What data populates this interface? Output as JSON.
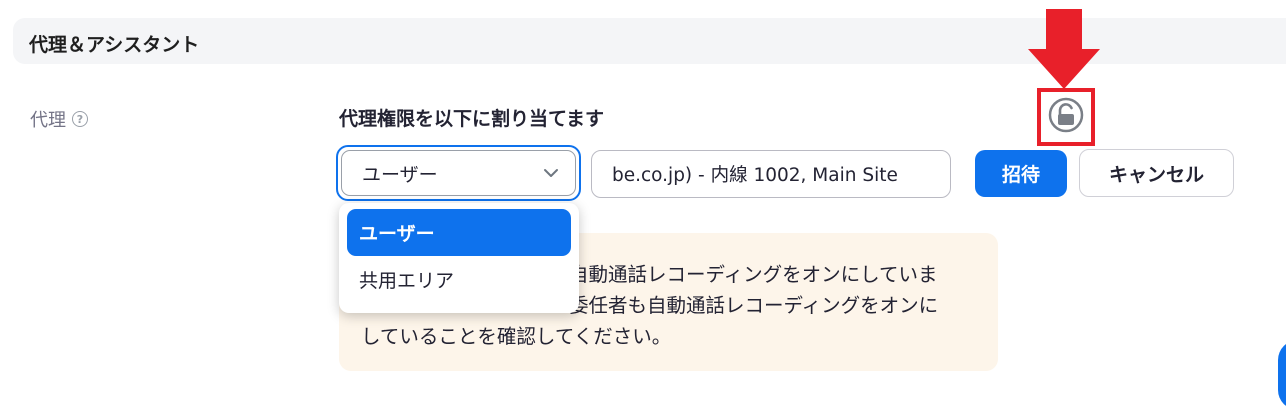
{
  "section": {
    "title": "代理＆アシスタント"
  },
  "delegate": {
    "label": "代理",
    "help_icon": "question-circle-icon",
    "assign_heading": "代理権限を以下に割り当てます",
    "select": {
      "value": "ユーザー",
      "options": [
        "ユーザー",
        "共用エリア"
      ],
      "selected_index": 0
    },
    "input_value": "be.co.jp) - 内線 1002, Main Site",
    "invite_label": "招待",
    "cancel_label": "キャンセル",
    "lock_icon": "unlock-icon",
    "notice_lines": [
      "自動通話レコーディングをオンにしていま",
      "委任者も自動通話レコーディングをオンに",
      "していることを確認してください。"
    ]
  },
  "colors": {
    "accent": "#0e72ed",
    "highlight": "#e8202a",
    "notice_bg": "#fdf5ea"
  }
}
